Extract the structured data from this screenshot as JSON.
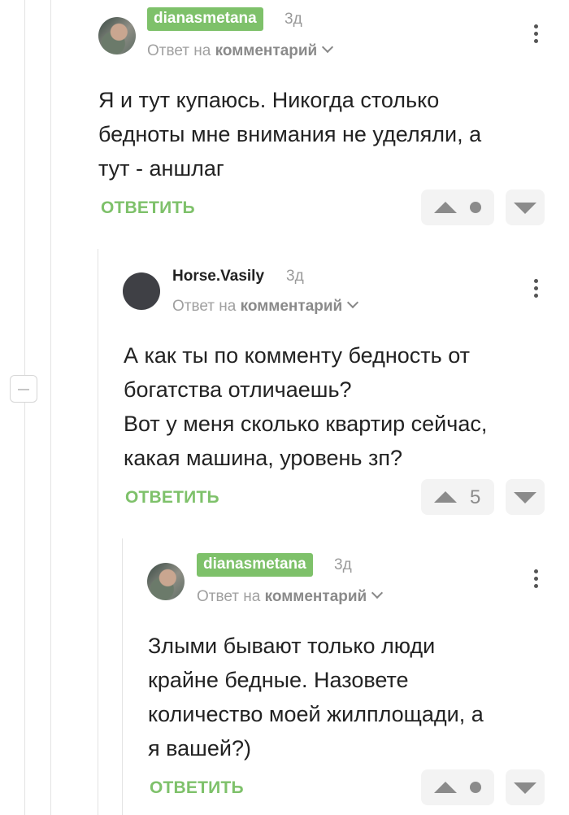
{
  "comments": [
    {
      "author": "dianasmetana",
      "time": "3д",
      "reply_prefix": "Ответ на",
      "reply_target": "комментарий",
      "text_lines": [
        "Я и тут купаюсь. Никогда столько",
        "бедноты мне внимания не уделяли, а",
        "тут - аншлаг"
      ],
      "reply_label": "ОТВЕТИТЬ",
      "rating": ""
    },
    {
      "author": "Horse.Vasily",
      "time": "3д",
      "reply_prefix": "Ответ на",
      "reply_target": "комментарий",
      "text_lines": [
        "А как ты по комменту бедность от",
        "богатства отличаешь?",
        "Вот у меня сколько квартир сейчас,",
        "какая машина, уровень зп?"
      ],
      "reply_label": "ОТВЕТИТЬ",
      "rating": "5"
    },
    {
      "author": "dianasmetana",
      "time": "3д",
      "reply_prefix": "Ответ на",
      "reply_target": "комментарий",
      "text_lines": [
        "Злыми бывают только люди",
        "крайне бедные. Назовете",
        "количество моей жилплощади, а",
        "я вашей?)"
      ],
      "reply_label": "ОТВЕТИТЬ",
      "rating": ""
    }
  ],
  "colors": {
    "accent": "#7ec16a",
    "vote_bg": "#f3f3f3",
    "icon": "#8b8b8b"
  }
}
